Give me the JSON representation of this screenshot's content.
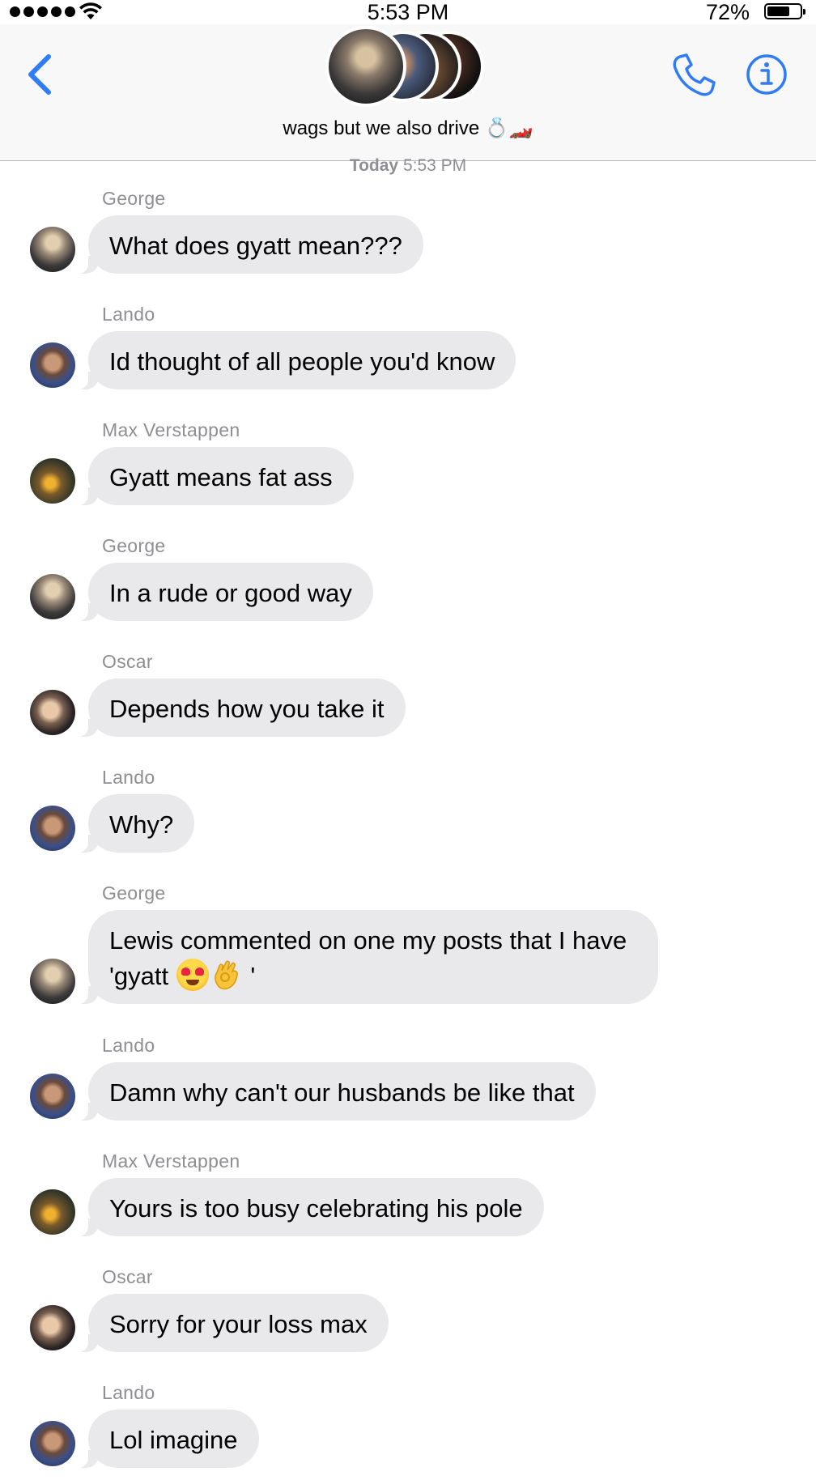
{
  "status_bar": {
    "time": "5:53 PM",
    "battery_percent": "72%",
    "battery_level": 0.72
  },
  "header": {
    "group_name": "wags but we also drive",
    "group_name_emoji": "💍🏎️",
    "icons": {
      "back": "chevron-left-icon",
      "call": "phone-icon",
      "info": "info-icon"
    },
    "accent_color": "#2f7cf6"
  },
  "timestamp": {
    "day": "Today",
    "time": "5:53 PM"
  },
  "messages": [
    {
      "sender": "George",
      "text": "What does gyatt mean???"
    },
    {
      "sender": "Lando",
      "text": "Id thought of all people you'd know"
    },
    {
      "sender": "Max Verstappen",
      "text": "Gyatt means fat ass"
    },
    {
      "sender": "George",
      "text": "In a rude or good way"
    },
    {
      "sender": "Oscar",
      "text": "Depends how you take it"
    },
    {
      "sender": "Lando",
      "text": "Why?"
    },
    {
      "sender": "George",
      "text_line1": "Lewis commented on one my posts that I have",
      "text_line2_prefix": "'gyatt",
      "text_line2_suffix": "'"
    },
    {
      "sender": "Lando",
      "text": "Damn why can't our husbands be like that"
    },
    {
      "sender": "Max Verstappen",
      "text": "Yours is too busy celebrating his pole"
    },
    {
      "sender": "Oscar",
      "text": "Sorry for your loss max"
    },
    {
      "sender": "Lando",
      "text": "Lol imagine"
    }
  ],
  "colors": {
    "bubble_incoming": "#e9e9eb",
    "sender_label": "#8e8e93",
    "header_bg": "#f8f8f8"
  }
}
